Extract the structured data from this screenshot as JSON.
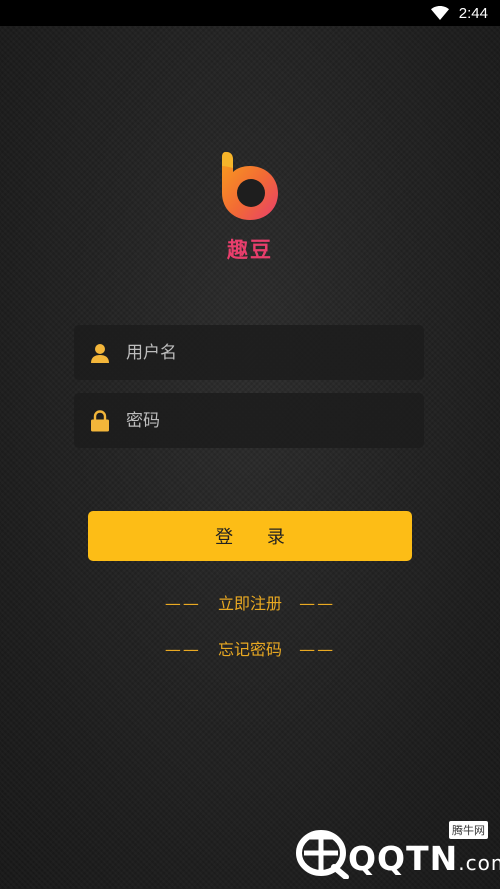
{
  "status_bar": {
    "time": "2:44",
    "wifi_icon": "wifi-icon"
  },
  "app": {
    "name": "趣豆",
    "logo_icon": "app-logo-b-icon",
    "brand_colors": {
      "logo_orange": "#f7931e",
      "logo_pink": "#e83e6c"
    }
  },
  "login_form": {
    "username": {
      "placeholder": "用户名",
      "value": "",
      "icon": "user-icon"
    },
    "password": {
      "placeholder": "密码",
      "value": "",
      "icon": "lock-icon"
    },
    "login_button": {
      "label": "登 录",
      "color": "#fdbd16"
    }
  },
  "links": {
    "register": {
      "dash_left": "——",
      "label": "立即注册",
      "dash_right": "——"
    },
    "forgot_password": {
      "dash_left": "——",
      "label": "忘记密码",
      "dash_right": "——"
    },
    "color": "#e9a922"
  },
  "watermark": {
    "brand": "QQTN",
    "suffix": ".com",
    "badge": "腾牛网"
  }
}
